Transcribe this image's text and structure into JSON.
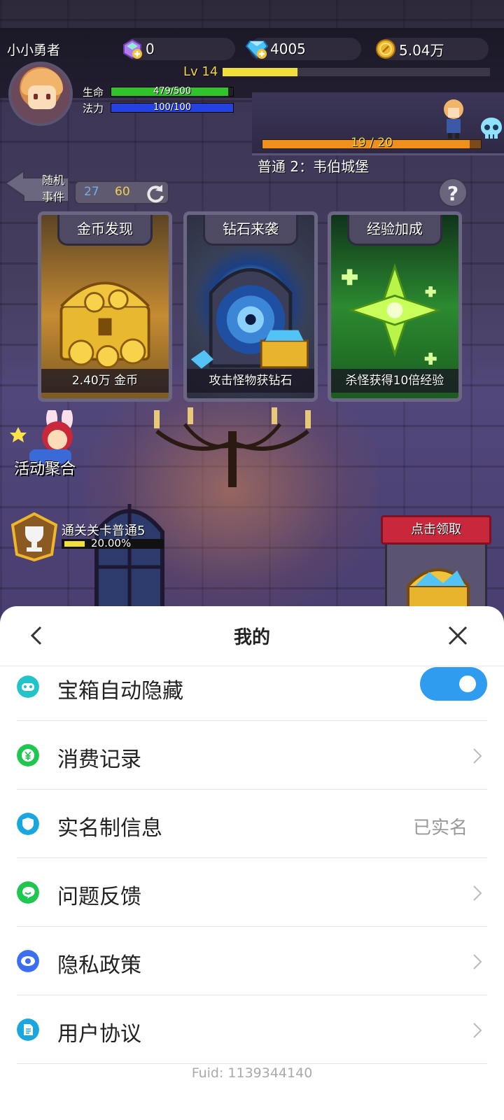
{
  "game": {
    "player": {
      "nickname": "小小勇者",
      "level": "Lv 14",
      "xp_progress": 0.28,
      "hp_label": "生命",
      "hp_text": "479/500",
      "hp_progress": 0.958,
      "mp_label": "法力",
      "mp_text": "100/100",
      "mp_progress": 1.0
    },
    "resources": {
      "crystal": "0",
      "diamond": "4005",
      "gold": "5.04万"
    },
    "stage": {
      "progress_text": "19 / 20",
      "progress": 0.95,
      "name": "普通 2：韦伯城堡"
    },
    "random_event": {
      "label_line1": "随机",
      "label_line2": "事件",
      "count_a": "27",
      "count_b": "60"
    },
    "cards": [
      {
        "title": "金币发现",
        "caption": "2.40万 金币"
      },
      {
        "title": "钻石来袭",
        "caption": "攻击怪物获钻石"
      },
      {
        "title": "经验加成",
        "caption": "杀怪获得10倍经验"
      }
    ],
    "activity_label": "活动聚合",
    "quest": {
      "text": "通关关卡普通5",
      "percent_text": "20.00%",
      "progress": 0.2
    },
    "claim_label": "点击领取"
  },
  "sheet": {
    "title": "我的",
    "rows": [
      {
        "label": "宝箱自动隐藏",
        "type": "toggle",
        "toggle_on": true,
        "icon": "gamepad-icon",
        "color": "#22c3c9"
      },
      {
        "label": "消费记录",
        "type": "chevron",
        "icon": "yen-icon",
        "color": "#1fc64f"
      },
      {
        "label": "实名制信息",
        "type": "value",
        "value": "已实名",
        "icon": "shield-icon",
        "color": "#1aa7e0"
      },
      {
        "label": "问题反馈",
        "type": "chevron",
        "icon": "chat-icon",
        "color": "#1fc64f"
      },
      {
        "label": "隐私政策",
        "type": "chevron",
        "icon": "eye-icon",
        "color": "#3b6ff0"
      },
      {
        "label": "用户协议",
        "type": "chevron",
        "icon": "document-icon",
        "color": "#1aa7e0"
      }
    ],
    "fuid": "Fuid: 1139344140"
  }
}
